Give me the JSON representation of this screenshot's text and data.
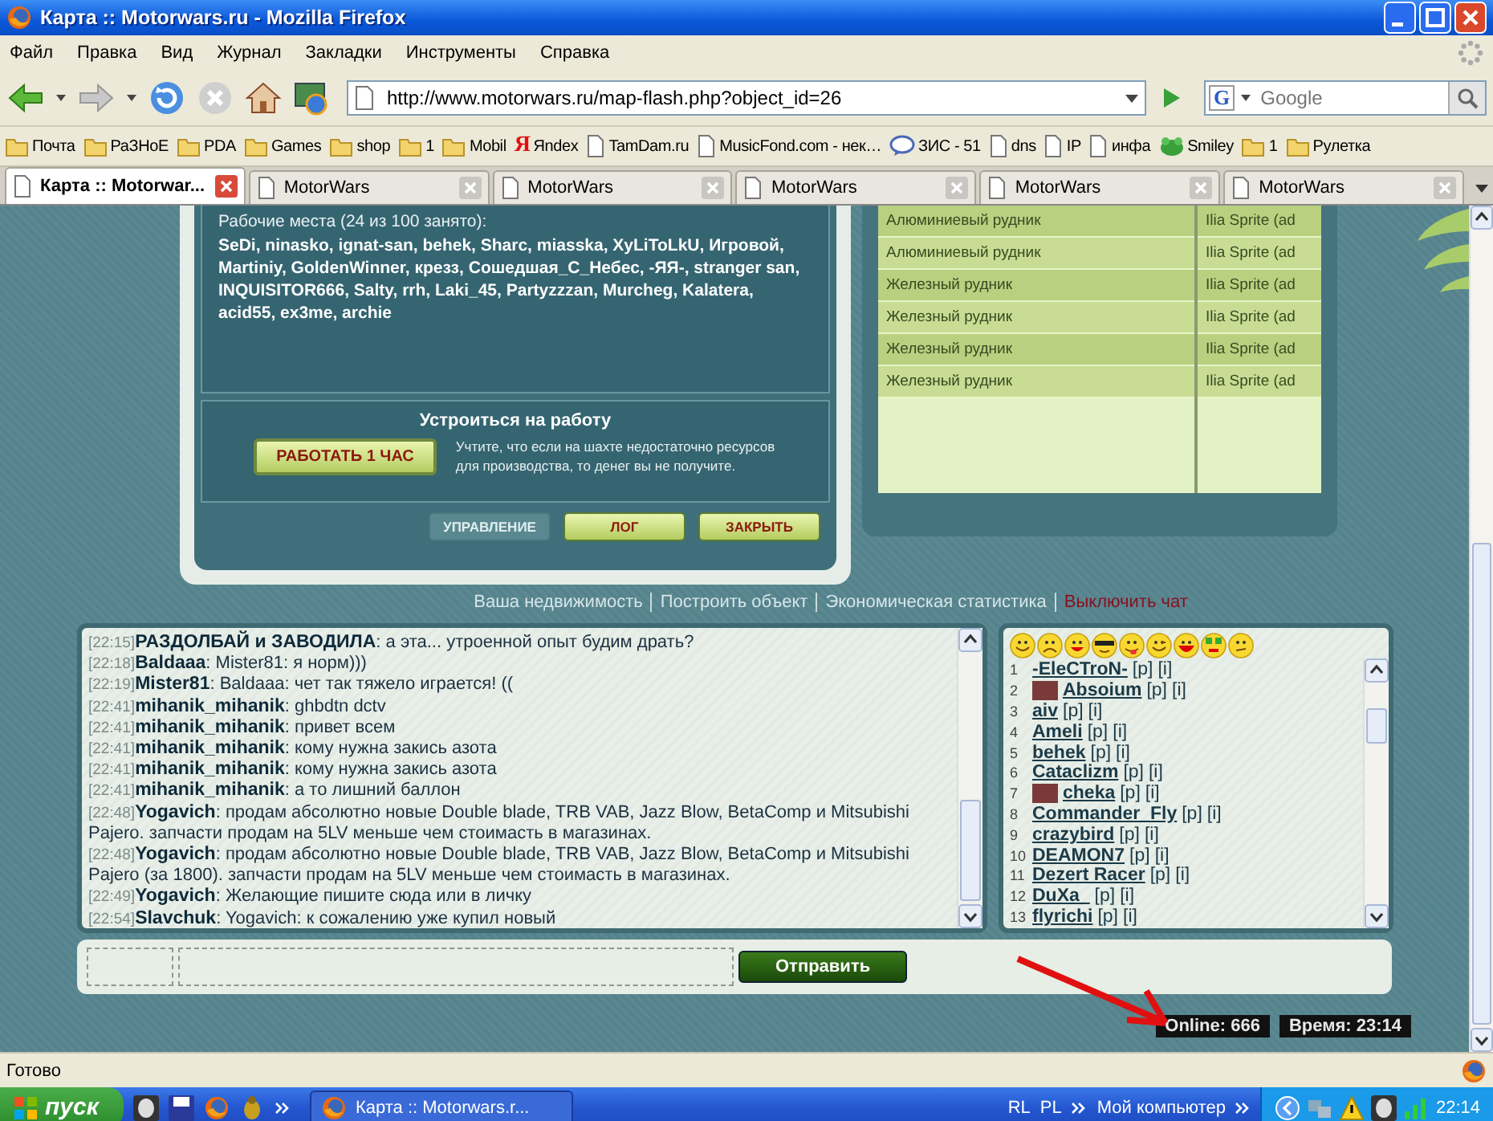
{
  "window": {
    "title": "Карта :: Motorwars.ru - Mozilla Firefox"
  },
  "menu": [
    "Файл",
    "Правка",
    "Вид",
    "Журнал",
    "Закладки",
    "Инструменты",
    "Справка"
  ],
  "address_bar": {
    "value": "http://www.motorwars.ru/map-flash.php?object_id=26"
  },
  "search": {
    "engine_label": "G",
    "placeholder": "Google"
  },
  "bookmarks": [
    {
      "label": "Почта",
      "kind": "folder"
    },
    {
      "label": "РаЗНоЕ",
      "kind": "folder"
    },
    {
      "label": "PDA",
      "kind": "folder"
    },
    {
      "label": "Games",
      "kind": "folder"
    },
    {
      "label": "shop",
      "kind": "folder"
    },
    {
      "label": "1",
      "kind": "folder"
    },
    {
      "label": "Mobil",
      "kind": "folder"
    },
    {
      "label": "Яndex",
      "kind": "letter",
      "icon": "Я"
    },
    {
      "label": "TamDam.ru",
      "kind": "page"
    },
    {
      "label": "MusicFond.com - нек…",
      "kind": "page"
    },
    {
      "label": "ЗИС - 51",
      "kind": "bubble"
    },
    {
      "label": "dns",
      "kind": "page"
    },
    {
      "label": "IP",
      "kind": "page"
    },
    {
      "label": "инфа",
      "kind": "page"
    },
    {
      "label": "Smiley",
      "kind": "frog"
    },
    {
      "label": "1",
      "kind": "folder"
    },
    {
      "label": "Рулетка",
      "kind": "folder"
    }
  ],
  "tabs": [
    {
      "label": "Карта :: Motorwar...",
      "selected": true
    },
    {
      "label": "MotorWars",
      "selected": false
    },
    {
      "label": "MotorWars",
      "selected": false
    },
    {
      "label": "MotorWars",
      "selected": false
    },
    {
      "label": "MotorWars",
      "selected": false
    },
    {
      "label": "MotorWars",
      "selected": false
    }
  ],
  "game": {
    "workers": {
      "heading": "Рабочие места (24 из 100 занято):",
      "names": "SeDi, ninasko, ignat-san, behek, Sharc, miasska, XyLiToLkU, Игровой, Martiniy, GoldenWinner, крезз, Сошедшая_С_Небес, -ЯЯ-, stranger san, INQUISITOR666, Salty, rrh, Laki_45, Partyzzzan, Murcheg, Kalatera, acid55, ex3me, archie"
    },
    "job": {
      "title": "Устроиться на работу",
      "button": "РАБОТАТЬ 1 ЧАС",
      "note": "Учтите, что если на шахте недостаточно ресурсов для производства, то денег вы не получите."
    },
    "panel_buttons": [
      {
        "label": "УПРАВЛЕНИЕ",
        "disabled": true
      },
      {
        "label": "ЛОГ",
        "disabled": false
      },
      {
        "label": "ЗАКРЫТЬ",
        "disabled": false
      }
    ],
    "mines_table": {
      "rows": [
        [
          "Алюминиевый рудник",
          "Ilia Sprite (ad"
        ],
        [
          "Алюминиевый рудник",
          "Ilia Sprite (ad"
        ],
        [
          "Железный рудник",
          "Ilia Sprite (ad"
        ],
        [
          "Железный рудник",
          "Ilia Sprite (ad"
        ],
        [
          "Железный рудник",
          "Ilia Sprite (ad"
        ],
        [
          "Железный рудник",
          "Ilia Sprite (ad"
        ]
      ]
    },
    "links": [
      {
        "label": "Ваша недвижимость",
        "kind": "nav"
      },
      {
        "label": "Построить объект",
        "kind": "nav"
      },
      {
        "label": "Экономическая статистика",
        "kind": "nav"
      },
      {
        "label": "Выключить чат",
        "kind": "action"
      }
    ]
  },
  "chat": {
    "messages": [
      {
        "time": "[22:15]",
        "user": "РАЗДОЛБАЙ и ЗАВОДИЛА",
        "text": ": а эта... утроенной опыт будим драть?"
      },
      {
        "time": "[22:18]",
        "user": "Baldaaa",
        "text": ": Mister81: я норм)))"
      },
      {
        "time": "[22:19]",
        "user": "Mister81",
        "text": ": Baldaaa: чет так тяжело играется! (("
      },
      {
        "time": "[22:41]",
        "user": "mihanik_mihanik",
        "text": ": ghbdtn dctv"
      },
      {
        "time": "[22:41]",
        "user": "mihanik_mihanik",
        "text": ": привет всем"
      },
      {
        "time": "[22:41]",
        "user": "mihanik_mihanik",
        "text": ": кому нужна закись азота"
      },
      {
        "time": "[22:41]",
        "user": "mihanik_mihanik",
        "text": ": кому нужна закись азота"
      },
      {
        "time": "[22:41]",
        "user": "mihanik_mihanik",
        "text": ": а то лишний баллон"
      },
      {
        "time": "[22:48]",
        "user": "Yogavich",
        "text": ": продам абсолютно новые Double blade, TRB VAB, Jazz Blow, BetaComp и Mitsubishi Pajero. запчасти продам на 5LV меньше чем стоимасть в магазинах."
      },
      {
        "time": "[22:48]",
        "user": "Yogavich",
        "text": ": продам абсолютно новые Double blade, TRB VAB, Jazz Blow, BetaComp и Mitsubishi Pajero (за 1800). запчасти продам на 5LV меньше чем стоимасть в магазинах."
      },
      {
        "time": "[22:49]",
        "user": "Yogavich",
        "text": ": Желающие пишите сюда или в личку"
      },
      {
        "time": "[22:54]",
        "user": "Slavchuk",
        "text": ": Yogavich: к сожалению уже купил новый"
      }
    ]
  },
  "users": [
    {
      "number": "1",
      "name": "-EleCTroN-",
      "avatar": false,
      "links": [
        "[p]",
        "[i]"
      ]
    },
    {
      "number": "2",
      "name": "Absoium",
      "avatar": true,
      "links": [
        "[p]",
        "[i]"
      ]
    },
    {
      "number": "3",
      "name": "aiv",
      "avatar": false,
      "links": [
        "[p]",
        "[i]"
      ]
    },
    {
      "number": "4",
      "name": "Ameli",
      "avatar": false,
      "links": [
        "[p]",
        "[i]"
      ]
    },
    {
      "number": "5",
      "name": "behek",
      "avatar": false,
      "links": [
        "[p]",
        "[i]"
      ]
    },
    {
      "number": "6",
      "name": "Cataclizm",
      "avatar": false,
      "links": [
        "[p]",
        "[i]"
      ]
    },
    {
      "number": "7",
      "name": "cheka",
      "avatar": true,
      "links": [
        "[p]",
        "[i]"
      ]
    },
    {
      "number": "8",
      "name": "Commander_Fly",
      "avatar": false,
      "links": [
        "[p]",
        "[i]"
      ]
    },
    {
      "number": "9",
      "name": "crazybird",
      "avatar": false,
      "links": [
        "[p]",
        "[i]"
      ]
    },
    {
      "number": "10",
      "name": "DEAMON7",
      "avatar": false,
      "links": [
        "[p]",
        "[i]"
      ]
    },
    {
      "number": "11",
      "name": "Dezert Racer",
      "avatar": false,
      "links": [
        "[p]",
        "[i]"
      ]
    },
    {
      "number": "12",
      "name": "DuXa_",
      "avatar": false,
      "links": [
        "[p]",
        "[i]"
      ]
    },
    {
      "number": "13",
      "name": "flyrichi",
      "avatar": false,
      "links": [
        "[p]",
        "[i]"
      ]
    }
  ],
  "send_button": "Отправить",
  "online": "Online: 666",
  "server_time": "Время: 23:14",
  "status_bar": "Готово",
  "taskbar": {
    "start": "пуск",
    "task": "Карта :: Motorwars.r...",
    "languages": [
      "RL",
      "PL"
    ],
    "toolbar": "Мой компьютер",
    "clock": "22:14"
  }
}
